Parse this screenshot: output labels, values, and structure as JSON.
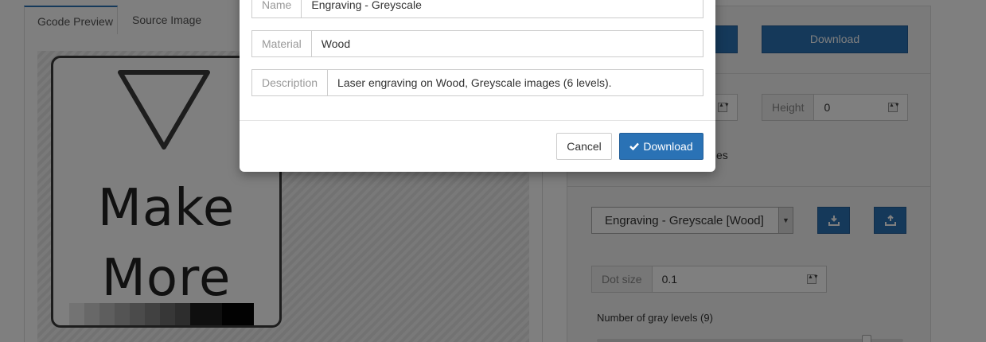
{
  "tabs": [
    {
      "label": "Gcode Preview",
      "active": true
    },
    {
      "label": "Source Image",
      "active": false
    }
  ],
  "preview": {
    "sign_line1": "Make",
    "sign_line2": "More",
    "gray_levels": [
      "#e6e6e6",
      "#d0d0d0",
      "#bdbdbd",
      "#a8a8a8",
      "#969696",
      "#828282",
      "#6e6e6e",
      "#5a5a5a",
      "#1e1e1e",
      "#050505"
    ]
  },
  "right_panel": {
    "download_top_label": "Download",
    "height_label": "Height",
    "height_value": "0",
    "partial_text": "es",
    "profile_select": "Engraving - Greyscale [Wood]",
    "dot_size_label": "Dot size",
    "dot_size_value": "0.1",
    "gray_levels_label": "Number of gray levels (9)",
    "gray_levels_value": 9
  },
  "modal": {
    "name_label": "Name",
    "name_value": "Engraving - Greyscale",
    "material_label": "Material",
    "material_value": "Wood",
    "description_label": "Description",
    "description_value": "Laser engraving on Wood, Greyscale images (6 levels).",
    "cancel_label": "Cancel",
    "download_label": "Download"
  },
  "colors": {
    "primary": "#2a72b5",
    "backdrop": "rgba(0,0,0,0.5)"
  }
}
